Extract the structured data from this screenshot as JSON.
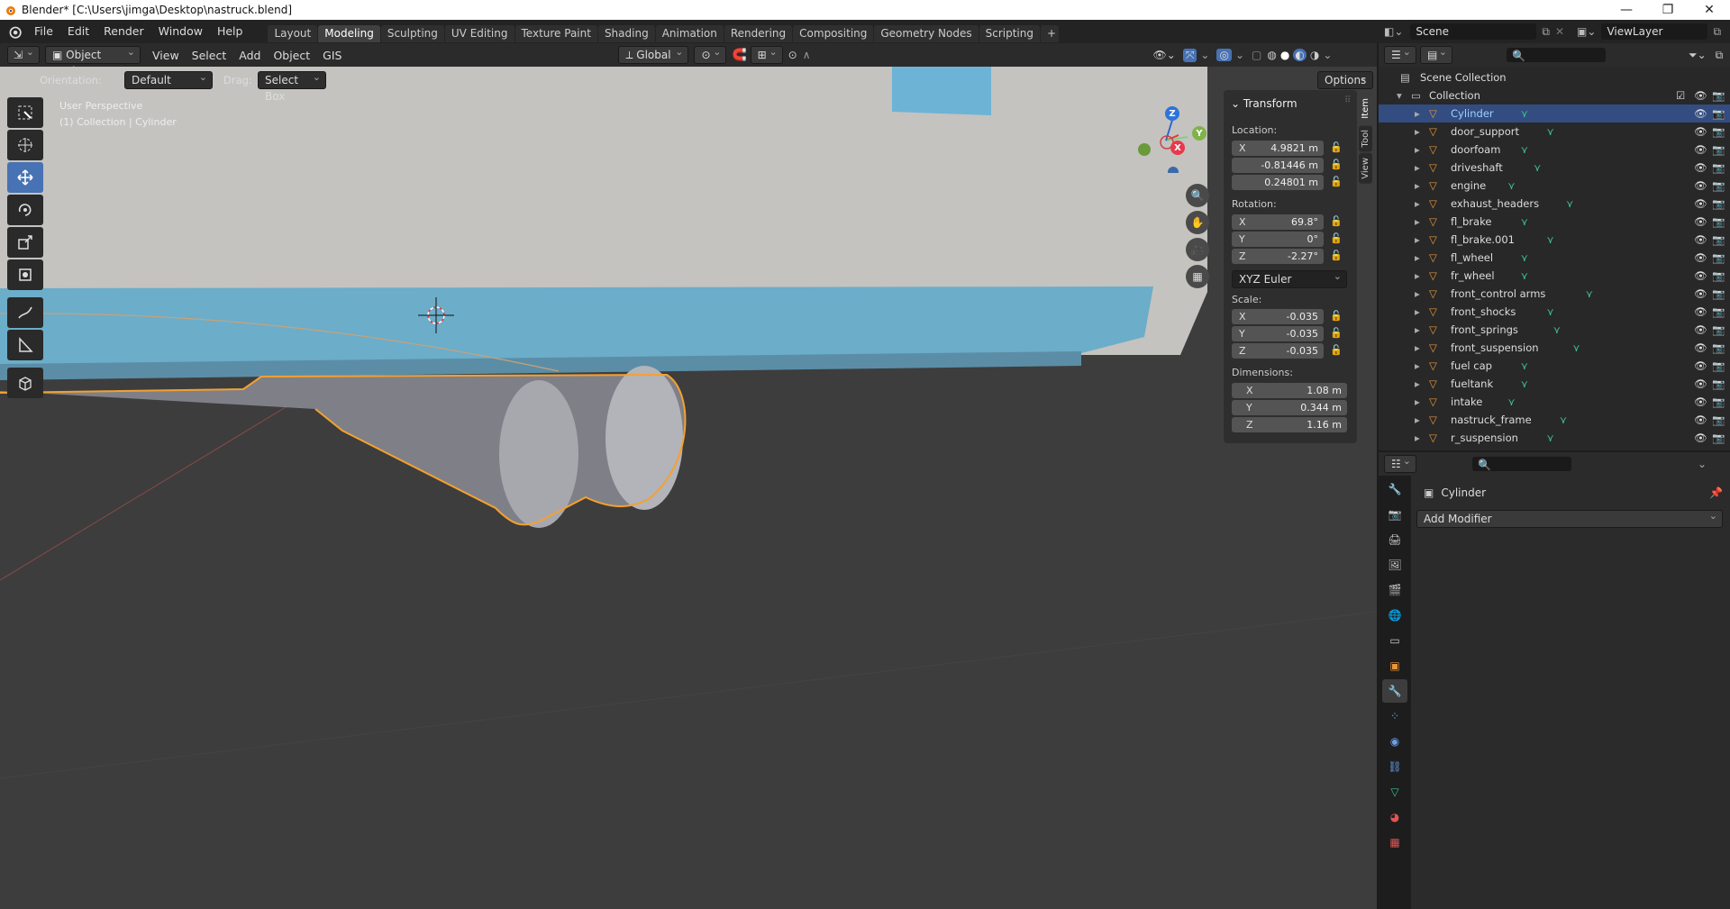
{
  "window": {
    "title": "Blender* [C:\\Users\\jimga\\Desktop\\nastruck.blend]"
  },
  "menu": [
    "File",
    "Edit",
    "Render",
    "Window",
    "Help"
  ],
  "workspaces": [
    "Layout",
    "Modeling",
    "Sculpting",
    "UV Editing",
    "Texture Paint",
    "Shading",
    "Animation",
    "Rendering",
    "Compositing",
    "Geometry Nodes",
    "Scripting"
  ],
  "active_workspace": "Modeling",
  "scene": {
    "name": "Scene",
    "view_layer": "ViewLayer"
  },
  "viewport_header": {
    "mode": "Object Mode",
    "menus": [
      "View",
      "Select",
      "Add",
      "Object",
      "GIS"
    ],
    "transform_orientation": "Global",
    "options": "Options"
  },
  "tool_settings": {
    "orientation_label": "Orientation:",
    "orientation_value": "Default",
    "drag_label": "Drag:",
    "drag_value": "Select Box"
  },
  "viewport": {
    "perspective": "User Perspective",
    "context": "(1) Collection | Cylinder"
  },
  "gizmo": {
    "x": "X",
    "y": "Y",
    "z": "Z"
  },
  "transform_panel": {
    "title": "Transform",
    "location_label": "Location:",
    "location": [
      {
        "axis": "X",
        "value": "4.9821 m"
      },
      {
        "axis": "",
        "value": "-0.81446 m"
      },
      {
        "axis": "",
        "value": "0.24801 m"
      }
    ],
    "rotation_label": "Rotation:",
    "rotation": [
      {
        "axis": "X",
        "value": "69.8°"
      },
      {
        "axis": "Y",
        "value": "0°"
      },
      {
        "axis": "Z",
        "value": "-2.27°"
      }
    ],
    "rotation_mode": "XYZ Euler",
    "scale_label": "Scale:",
    "scale": [
      {
        "axis": "X",
        "value": "-0.035"
      },
      {
        "axis": "Y",
        "value": "-0.035"
      },
      {
        "axis": "Z",
        "value": "-0.035"
      }
    ],
    "dimensions_label": "Dimensions:",
    "dimensions": [
      {
        "axis": "X",
        "value": "1.08 m"
      },
      {
        "axis": "Y",
        "value": "0.344 m"
      },
      {
        "axis": "Z",
        "value": "1.16 m"
      }
    ]
  },
  "sidebar_tabs": [
    "Item",
    "Tool",
    "View"
  ],
  "outliner": {
    "root": "Scene Collection",
    "collection": "Collection",
    "items": [
      "Cylinder",
      "door_support",
      "doorfoam",
      "driveshaft",
      "engine",
      "exhaust_headers",
      "fl_brake",
      "fl_brake.001",
      "fl_wheel",
      "fr_wheel",
      "front_control arms",
      "front_shocks",
      "front_springs",
      "front_suspension",
      "fuel cap",
      "fueltank",
      "intake",
      "nastruck_frame",
      "r_suspension"
    ],
    "selected": "Cylinder"
  },
  "properties": {
    "object_name": "Cylinder",
    "add_modifier": "Add Modifier"
  },
  "colors": {
    "selection_outline": "#f5a030",
    "accent_blue": "#4772b3",
    "mesh_icon_green": "#3fbf8f",
    "object_icon_orange": "#e8963c"
  }
}
